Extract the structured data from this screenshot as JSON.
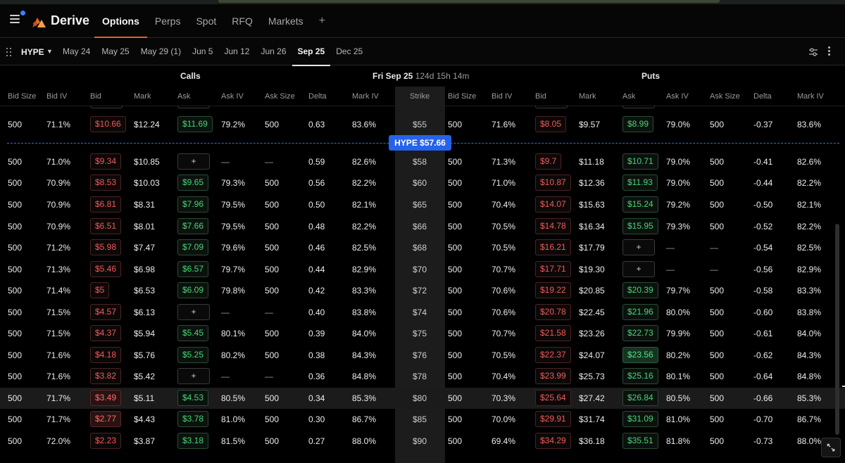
{
  "nav": {
    "brand": "Derive",
    "tabs": [
      {
        "label": "Options"
      },
      {
        "label": "Perps"
      },
      {
        "label": "Spot"
      },
      {
        "label": "RFQ"
      },
      {
        "label": "Markets"
      }
    ],
    "add_tab": "+"
  },
  "expiry_bar": {
    "asset": "HYPE",
    "expiries": [
      "May 24",
      "May 25",
      "May 29 (1)",
      "Jun 5",
      "Jun 12",
      "Jun 26",
      "Sep 25",
      "Dec 25"
    ],
    "active_expiry": "Sep 25"
  },
  "chain": {
    "calls_title": "Calls",
    "puts_title": "Puts",
    "expiry_title": "Fri Sep 25",
    "time_left": "124d 15h 14m",
    "index_price_label": "HYPE $57.66",
    "strike_header": "Strike",
    "call_headers": [
      "Bid Size",
      "Bid IV",
      "Bid",
      "Mark",
      "Ask",
      "Ask IV",
      "Ask Size",
      "Delta",
      "Mark IV"
    ],
    "put_headers": [
      "Bid Size",
      "Bid IV",
      "Bid",
      "Mark",
      "Ask",
      "Ask IV",
      "Ask Size",
      "Delta",
      "Mark IV"
    ],
    "rows": [
      {
        "strike": "$55",
        "c": [
          "500",
          "71.1%",
          "$10.66",
          "$12.24",
          "$11.69",
          "79.2%",
          "500",
          "0.63",
          "83.6%"
        ],
        "p": [
          "500",
          "71.6%",
          "$8.05",
          "$9.57",
          "$8.99",
          "79.0%",
          "500",
          "-0.37",
          "83.6%"
        ]
      },
      {
        "strike": "$58",
        "c": [
          "500",
          "71.0%",
          "$9.34",
          "$10.85",
          "+",
          "—",
          "—",
          "0.59",
          "82.6%"
        ],
        "p": [
          "500",
          "71.3%",
          "$9.7",
          "$11.18",
          "$10.71",
          "79.0%",
          "500",
          "-0.41",
          "82.6%"
        ]
      },
      {
        "strike": "$60",
        "c": [
          "500",
          "70.9%",
          "$8.53",
          "$10.03",
          "$9.65",
          "79.3%",
          "500",
          "0.56",
          "82.2%"
        ],
        "p": [
          "500",
          "71.0%",
          "$10.87",
          "$12.36",
          "$11.93",
          "79.0%",
          "500",
          "-0.44",
          "82.2%"
        ]
      },
      {
        "strike": "$65",
        "c": [
          "500",
          "70.9%",
          "$6.81",
          "$8.31",
          "$7.96",
          "79.5%",
          "500",
          "0.50",
          "82.1%"
        ],
        "p": [
          "500",
          "70.4%",
          "$14.07",
          "$15.63",
          "$15.24",
          "79.2%",
          "500",
          "-0.50",
          "82.1%"
        ]
      },
      {
        "strike": "$66",
        "c": [
          "500",
          "70.9%",
          "$6.51",
          "$8.01",
          "$7.66",
          "79.5%",
          "500",
          "0.48",
          "82.2%"
        ],
        "p": [
          "500",
          "70.5%",
          "$14.78",
          "$16.34",
          "$15.95",
          "79.3%",
          "500",
          "-0.52",
          "82.2%"
        ]
      },
      {
        "strike": "$68",
        "c": [
          "500",
          "71.2%",
          "$5.98",
          "$7.47",
          "$7.09",
          "79.6%",
          "500",
          "0.46",
          "82.5%"
        ],
        "p": [
          "500",
          "70.5%",
          "$16.21",
          "$17.79",
          "+",
          "—",
          "—",
          "-0.54",
          "82.5%"
        ]
      },
      {
        "strike": "$70",
        "c": [
          "500",
          "71.3%",
          "$5.46",
          "$6.98",
          "$6.57",
          "79.7%",
          "500",
          "0.44",
          "82.9%"
        ],
        "p": [
          "500",
          "70.7%",
          "$17.71",
          "$19.30",
          "+",
          "—",
          "—",
          "-0.56",
          "82.9%"
        ]
      },
      {
        "strike": "$72",
        "c": [
          "500",
          "71.4%",
          "$5",
          "$6.53",
          "$6.09",
          "79.8%",
          "500",
          "0.42",
          "83.3%"
        ],
        "p": [
          "500",
          "70.6%",
          "$19.22",
          "$20.85",
          "$20.39",
          "79.7%",
          "500",
          "-0.58",
          "83.3%"
        ]
      },
      {
        "strike": "$74",
        "c": [
          "500",
          "71.5%",
          "$4.57",
          "$6.13",
          "+",
          "—",
          "—",
          "0.40",
          "83.8%"
        ],
        "p": [
          "500",
          "70.6%",
          "$20.78",
          "$22.45",
          "$21.96",
          "80.0%",
          "500",
          "-0.60",
          "83.8%"
        ]
      },
      {
        "strike": "$75",
        "c": [
          "500",
          "71.5%",
          "$4.37",
          "$5.94",
          "$5.45",
          "80.1%",
          "500",
          "0.39",
          "84.0%"
        ],
        "p": [
          "500",
          "70.7%",
          "$21.58",
          "$23.26",
          "$22.73",
          "79.9%",
          "500",
          "-0.61",
          "84.0%"
        ]
      },
      {
        "strike": "$76",
        "c": [
          "500",
          "71.6%",
          "$4.18",
          "$5.76",
          "$5.25",
          "80.2%",
          "500",
          "0.38",
          "84.3%"
        ],
        "p": [
          "500",
          "70.5%",
          "$22.37",
          "$24.07",
          "$23.56",
          "80.2%",
          "500",
          "-0.62",
          "84.3%"
        ]
      },
      {
        "strike": "$78",
        "c": [
          "500",
          "71.6%",
          "$3.82",
          "$5.42",
          "+",
          "—",
          "—",
          "0.36",
          "84.8%"
        ],
        "p": [
          "500",
          "70.4%",
          "$23.99",
          "$25.73",
          "$25.16",
          "80.1%",
          "500",
          "-0.64",
          "84.8%"
        ]
      },
      {
        "strike": "$80",
        "c": [
          "500",
          "71.7%",
          "$3.49",
          "$5.11",
          "$4.53",
          "80.5%",
          "500",
          "0.34",
          "85.3%"
        ],
        "p": [
          "500",
          "70.3%",
          "$25.64",
          "$27.42",
          "$26.84",
          "80.5%",
          "500",
          "-0.66",
          "85.3%"
        ]
      },
      {
        "strike": "$85",
        "c": [
          "500",
          "71.7%",
          "$2.77",
          "$4.43",
          "$3.78",
          "81.0%",
          "500",
          "0.30",
          "86.7%"
        ],
        "p": [
          "500",
          "70.0%",
          "$29.91",
          "$31.74",
          "$31.09",
          "81.0%",
          "500",
          "-0.70",
          "86.7%"
        ]
      },
      {
        "strike": "$90",
        "c": [
          "500",
          "72.0%",
          "$2.23",
          "$3.87",
          "$3.18",
          "81.5%",
          "500",
          "0.27",
          "88.0%"
        ],
        "p": [
          "500",
          "69.4%",
          "$34.29",
          "$36.18",
          "$35.51",
          "81.8%",
          "500",
          "-0.73",
          "88.0%"
        ]
      }
    ]
  },
  "colors": {
    "accent": "#e8622a",
    "bid": "#f05a5a",
    "ask": "#4bd37a",
    "index_line": "#2563eb"
  },
  "icons": [
    "menu-icon",
    "derive-logo-icon",
    "drag-handle-icon",
    "chevron-down-icon",
    "settings-sliders-icon",
    "more-vertical-icon",
    "expand-icon"
  ]
}
